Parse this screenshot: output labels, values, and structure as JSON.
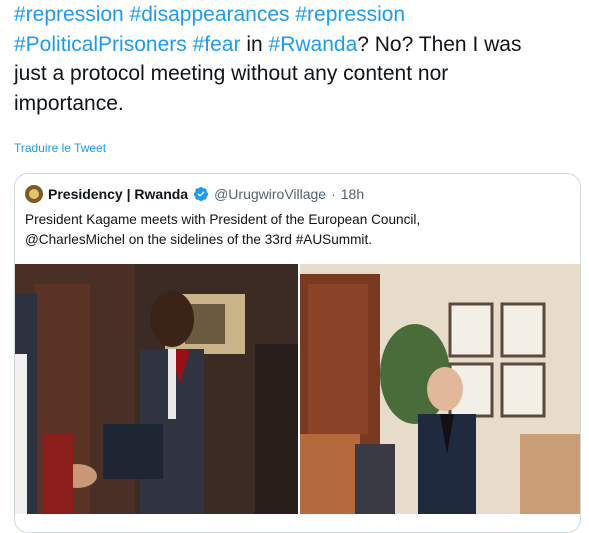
{
  "tweet": {
    "line1": [
      "#repression",
      "#disappearances",
      "#repression"
    ],
    "line2_tags": [
      "#PoliticalPrisoners",
      "#fear"
    ],
    "line2_in": "in",
    "line2_tag3": "#Rwanda",
    "line2_rest": "? No? Then I was",
    "line3": "just a protocol meeting without any content nor",
    "line4": "importance."
  },
  "translate_label": "Traduire le Tweet",
  "quote": {
    "name": "Presidency | Rwanda",
    "handle": "@UrugwiroVillage",
    "separator": "·",
    "time": "18h",
    "body_line1": "President Kagame meets with President of the European Council,",
    "body_line2": "@CharlesMichel on the sidelines of the 33rd #AUSummit."
  },
  "colors": {
    "link": "#1d9bf0",
    "text": "#0f1419",
    "muted": "#536471",
    "border": "#cfd9de"
  },
  "icons": [
    "verified-badge-icon",
    "presidency-seal-avatar"
  ]
}
